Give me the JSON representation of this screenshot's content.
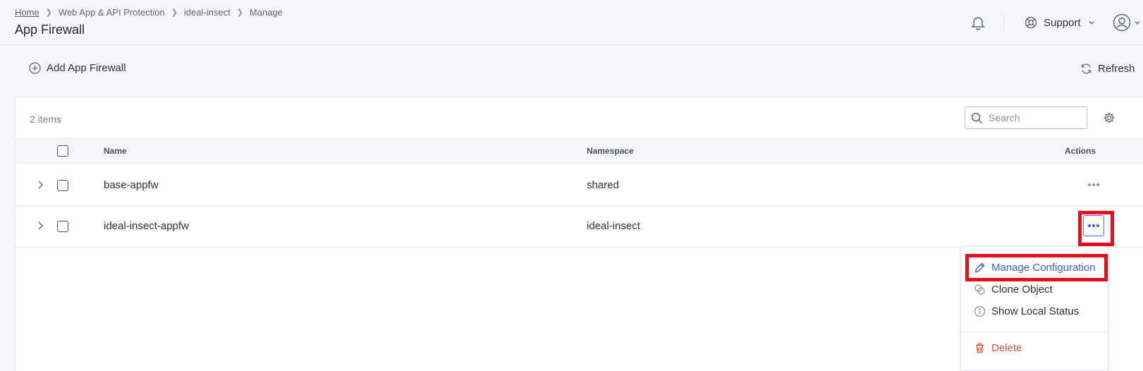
{
  "breadcrumb": {
    "home": "Home",
    "level2": "Web App & API Protection",
    "level3": "ideal-insect",
    "level4": "Manage"
  },
  "page_title": "App Firewall",
  "header": {
    "support_label": "Support"
  },
  "toolbar": {
    "add_label": "Add App Firewall",
    "refresh_label": "Refresh"
  },
  "table": {
    "count_label": "2 items",
    "search_placeholder": "Search",
    "columns": {
      "name": "Name",
      "namespace": "Namespace",
      "actions": "Actions"
    },
    "rows": [
      {
        "name": "base-appfw",
        "namespace": "shared"
      },
      {
        "name": "ideal-insect-appfw",
        "namespace": "ideal-insect"
      }
    ]
  },
  "action_menu": {
    "items": [
      {
        "label": "Manage Configuration",
        "icon": "pencil-icon"
      },
      {
        "label": "Clone Object",
        "icon": "clone-icon"
      },
      {
        "label": "Show Local Status",
        "icon": "info-icon"
      }
    ],
    "delete_label": "Delete"
  },
  "colors": {
    "accent": "#3b5bdb",
    "danger": "#e5533c",
    "highlight": "#e3111b"
  }
}
